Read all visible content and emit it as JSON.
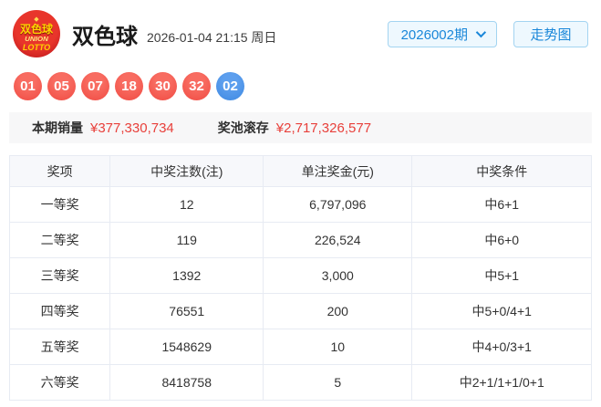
{
  "header": {
    "logo": {
      "line1": "双色球",
      "line2": "UNION",
      "line3": "LOTTO"
    },
    "title": "双色球",
    "datetime": "2026-01-04 21:15 周日",
    "issue_select_label": "2026002期",
    "trend_button_label": "走势图"
  },
  "draw": {
    "red_balls": [
      "01",
      "05",
      "07",
      "18",
      "30",
      "32"
    ],
    "blue_ball": "02"
  },
  "stats": {
    "sales_label": "本期销量",
    "sales_value": "¥377,330,734",
    "pool_label": "奖池滚存",
    "pool_value": "¥2,717,326,577"
  },
  "table": {
    "headers": [
      "奖项",
      "中奖注数(注)",
      "单注奖金(元)",
      "中奖条件"
    ],
    "rows": [
      {
        "prize": "一等奖",
        "count": "12",
        "amount": "6,797,096",
        "condition": "中6+1"
      },
      {
        "prize": "二等奖",
        "count": "119",
        "amount": "226,524",
        "condition": "中6+0"
      },
      {
        "prize": "三等奖",
        "count": "1392",
        "amount": "3,000",
        "condition": "中5+1"
      },
      {
        "prize": "四等奖",
        "count": "76551",
        "amount": "200",
        "condition": "中5+0/4+1"
      },
      {
        "prize": "五等奖",
        "count": "1548629",
        "amount": "10",
        "condition": "中4+0/3+1"
      },
      {
        "prize": "六等奖",
        "count": "8418758",
        "amount": "5",
        "condition": "中2+1/1+1/0+1"
      }
    ]
  },
  "colors": {
    "red_ball": "#f04b43",
    "blue_ball": "#3e89e2",
    "accent_blue": "#1a87d9",
    "value_red": "#e8403b"
  }
}
